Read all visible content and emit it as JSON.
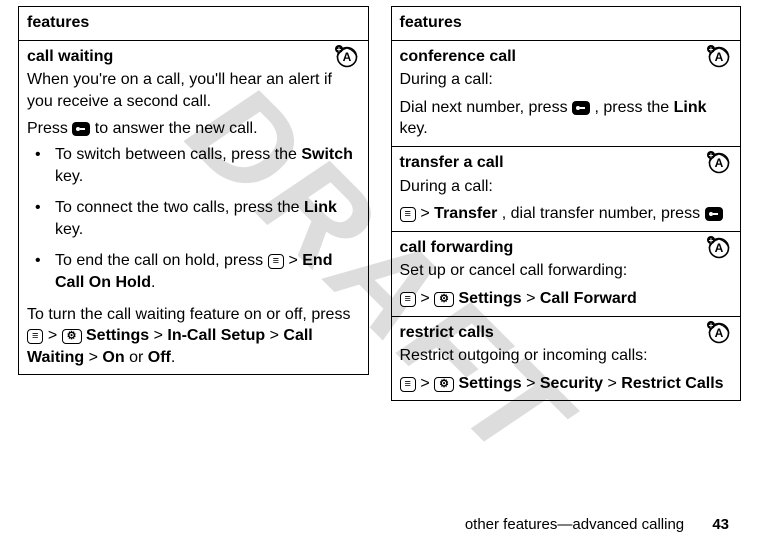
{
  "watermark": "DRAFT",
  "left": {
    "header": "features",
    "section": {
      "title": "call waiting",
      "p1": "When you're on a call, you'll hear an alert if you receive a second call.",
      "p2_a": "Press ",
      "p2_b": " to answer the new call.",
      "b1_a": "To switch between calls, press the ",
      "b1_key": "Switch",
      "b1_b": " key.",
      "b2_a": "To connect the two calls, press the ",
      "b2_key": "Link",
      "b2_b": " key.",
      "b3_a": "To end the call on hold, press ",
      "b3_path": "End Call On Hold",
      "p3_a": "To turn the call waiting feature on or off, press ",
      "p3_settings": "Settings",
      "p3_incall": "In-Call Setup",
      "p3_cw": "Call Waiting",
      "p3_on": "On",
      "p3_or": " or ",
      "p3_off": "Off"
    }
  },
  "right": {
    "header": "features",
    "s1": {
      "title": "conference call",
      "p1": "During a call:",
      "p2_a": "Dial next number, press ",
      "p2_b": ", press the ",
      "p2_key": "Link",
      "p2_c": " key."
    },
    "s2": {
      "title": "transfer a call",
      "p1": "During a call:",
      "p2_transfer": "Transfer",
      "p2_mid": ", dial transfer number, press "
    },
    "s3": {
      "title": "call forwarding",
      "p1": "Set up or cancel call forwarding:",
      "p2_settings": "Settings",
      "p2_callfwd": "Call Forward"
    },
    "s4": {
      "title": "restrict calls",
      "p1": "Restrict outgoing or incoming calls:",
      "p2_settings": "Settings",
      "p2_security": "Security",
      "p2_restrict": "Restrict Calls"
    }
  },
  "footer": {
    "text": "other features—advanced calling",
    "page": "43"
  },
  "gt": ">"
}
